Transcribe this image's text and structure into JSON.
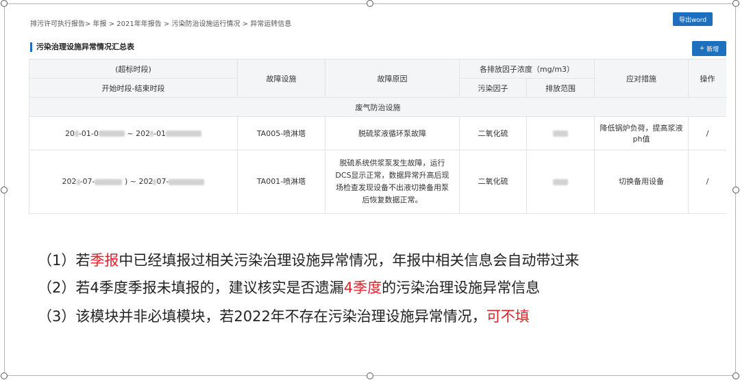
{
  "breadcrumb": "排污许可执行报告> 年报 > 2021年年报告 > 污染防治设施运行情况 > 异常运转信息",
  "toolbar": {
    "export_label": "导出word",
    "add_label": "新增",
    "add_icon": "plus-icon"
  },
  "section_title": "污染治理设施异常情况汇总表",
  "table": {
    "headers": {
      "time_top": "(超标时段)",
      "time_bottom": "开始时段-结束时段",
      "facility": "故障设施",
      "cause": "故障原因",
      "concentration": "各排放因子浓度（mg/m3）",
      "pollutant": "污染因子",
      "range": "排放范围",
      "measures": "应对措施",
      "ops": "操作"
    },
    "group": "废气防治设施",
    "rows": [
      {
        "start": "20",
        "start_mid": "-01-0",
        "sep": "~",
        "end": "202",
        "end_mid": "-01",
        "facility": "TA005-喷淋塔",
        "cause": "脱硫浆液循环泵故障",
        "pollutant": "二氧化硫",
        "measures": "降低锅炉负荷，提高浆液ph值",
        "ops": "/"
      },
      {
        "start": "202",
        "start_mid": "-07-",
        "sep": ") ~",
        "end": "202",
        "end_mid": "07-",
        "facility": "TA001-喷淋塔",
        "cause": "脱硫系统供浆泵发生故障，运行DCS显示正常，数据异常升高后现场检查发现设备不出液切换备用泵后恢复数据正常。",
        "pollutant": "二氧化硫",
        "measures": "切换备用设备",
        "ops": "/"
      }
    ]
  },
  "notes": [
    {
      "a": "（1）若",
      "red": "季报",
      "b": "中已经填报过相关污染治理设施异常情况，年报中相关信息会自动带过来"
    },
    {
      "a": "（2）若4季度季报未填报的，建议核实是否遗漏",
      "red": "4季度",
      "b": "的污染治理设施异常信息"
    },
    {
      "a": "（3）该模块并非必填模块，若2022年不存在污染治理设施异常情况，",
      "red": "可不填",
      "b": ""
    }
  ],
  "colors": {
    "accent": "#1f6fbf",
    "highlight": "#e6202b"
  }
}
